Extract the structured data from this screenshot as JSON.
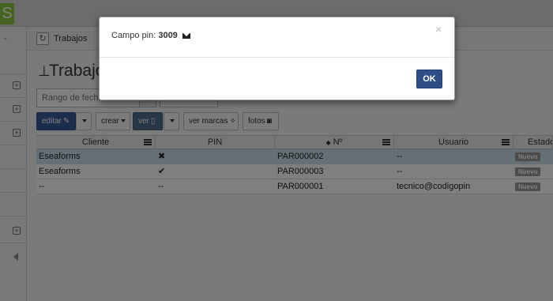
{
  "app": {
    "logo_letter": "S"
  },
  "breadcrumb": {
    "label": "Trabajos"
  },
  "page": {
    "title": "Trabajos"
  },
  "filter": {
    "date_placeholder": "Rango de fechas"
  },
  "toolbar": {
    "edit_label": "editar",
    "create_label": "crear",
    "view_label": "ver",
    "view_marks_label": "ver marcas",
    "photos_label": "fotos"
  },
  "table": {
    "columns": [
      "Cliente",
      "PIN",
      "Nº",
      "Usuario",
      "Estado"
    ],
    "rows": [
      {
        "cliente": "Eseaforms",
        "pin": "✖",
        "numero": "PAR000002",
        "usuario": "--",
        "estado": "Nuevo"
      },
      {
        "cliente": "Eseaforms",
        "pin": "✔",
        "numero": "PAR000003",
        "usuario": "--",
        "estado": "Nuevo"
      },
      {
        "cliente": "--",
        "pin": "--",
        "numero": "PAR000001",
        "usuario": "tecnico@codigopin",
        "estado": "Nuevo"
      }
    ]
  },
  "modal": {
    "label": "Campo pin:",
    "pin_value": "3009",
    "close_glyph": "×",
    "ok_label": "OK"
  },
  "colors": {
    "primary": "#3a5a9b",
    "selected_row": "#c8e1ec",
    "logo": "#8dc63f",
    "badge": "#999999"
  }
}
